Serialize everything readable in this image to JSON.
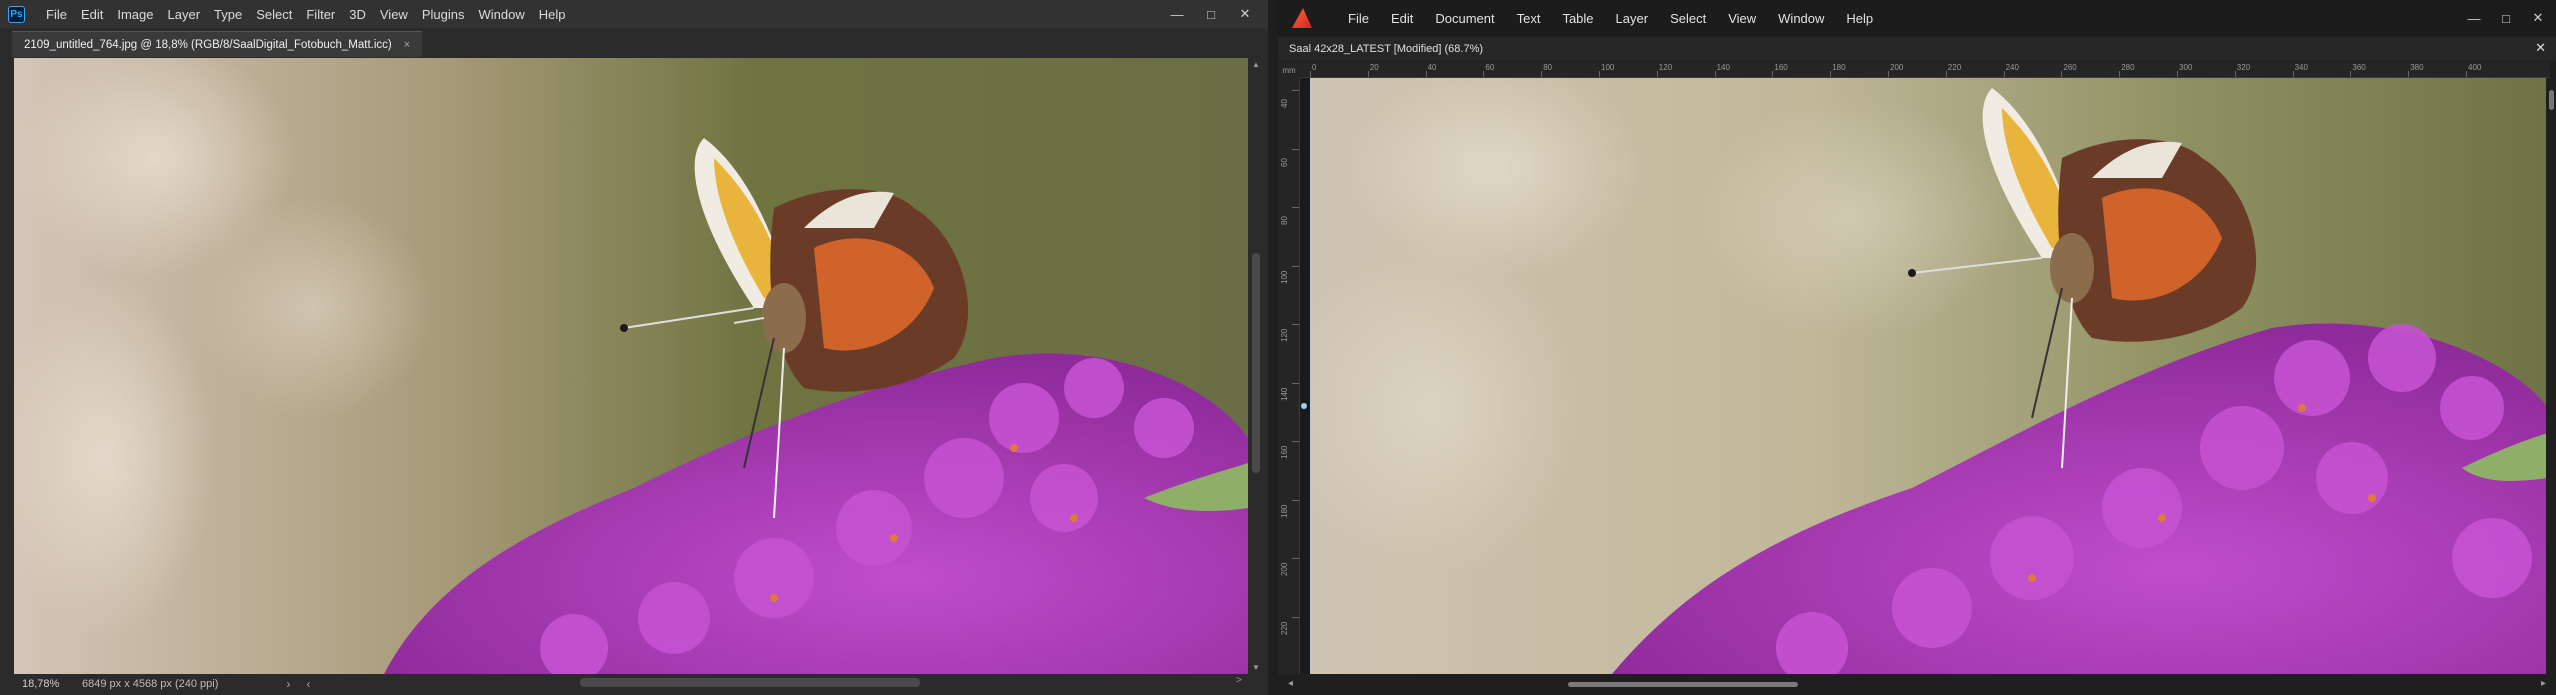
{
  "photoshop": {
    "menu": [
      "File",
      "Edit",
      "Image",
      "Layer",
      "Type",
      "Select",
      "Filter",
      "3D",
      "View",
      "Plugins",
      "Window",
      "Help"
    ],
    "logo_text": "Ps",
    "tab_title": "2109_untitled_764.jpg @ 18,8% (RGB/8/SaalDigital_Fotobuch_Matt.icc)",
    "tab_close": "×",
    "status_zoom": "18,78%",
    "status_dims": "6849 px x 4568 px (240 ppi)",
    "status_arrow_right": "›",
    "status_arrow_left": "‹",
    "window_controls": [
      "—",
      "□",
      "✕"
    ]
  },
  "affinity": {
    "menu": [
      "File",
      "Edit",
      "Document",
      "Text",
      "Table",
      "Layer",
      "Select",
      "View",
      "Window",
      "Help"
    ],
    "doc_title": "Saal 42x28_LATEST [Modified] (68.7%)",
    "doc_close": "✕",
    "ruler_unit": "mm",
    "h_ruler_labels": [
      "0",
      "20",
      "40",
      "60",
      "80",
      "100",
      "120",
      "140",
      "160",
      "180",
      "200",
      "220",
      "240",
      "260",
      "280",
      "300",
      "320",
      "340",
      "360",
      "380",
      "400"
    ],
    "v_ruler_labels": [
      "40",
      "60",
      "80",
      "100",
      "120",
      "140",
      "160",
      "180",
      "200",
      "220"
    ],
    "window_controls": [
      "—",
      "□",
      "✕"
    ]
  },
  "colors": {
    "flower_magenta": "#b23ec0",
    "background_olive": "#6f7441",
    "background_beige": "#cbbfae"
  }
}
